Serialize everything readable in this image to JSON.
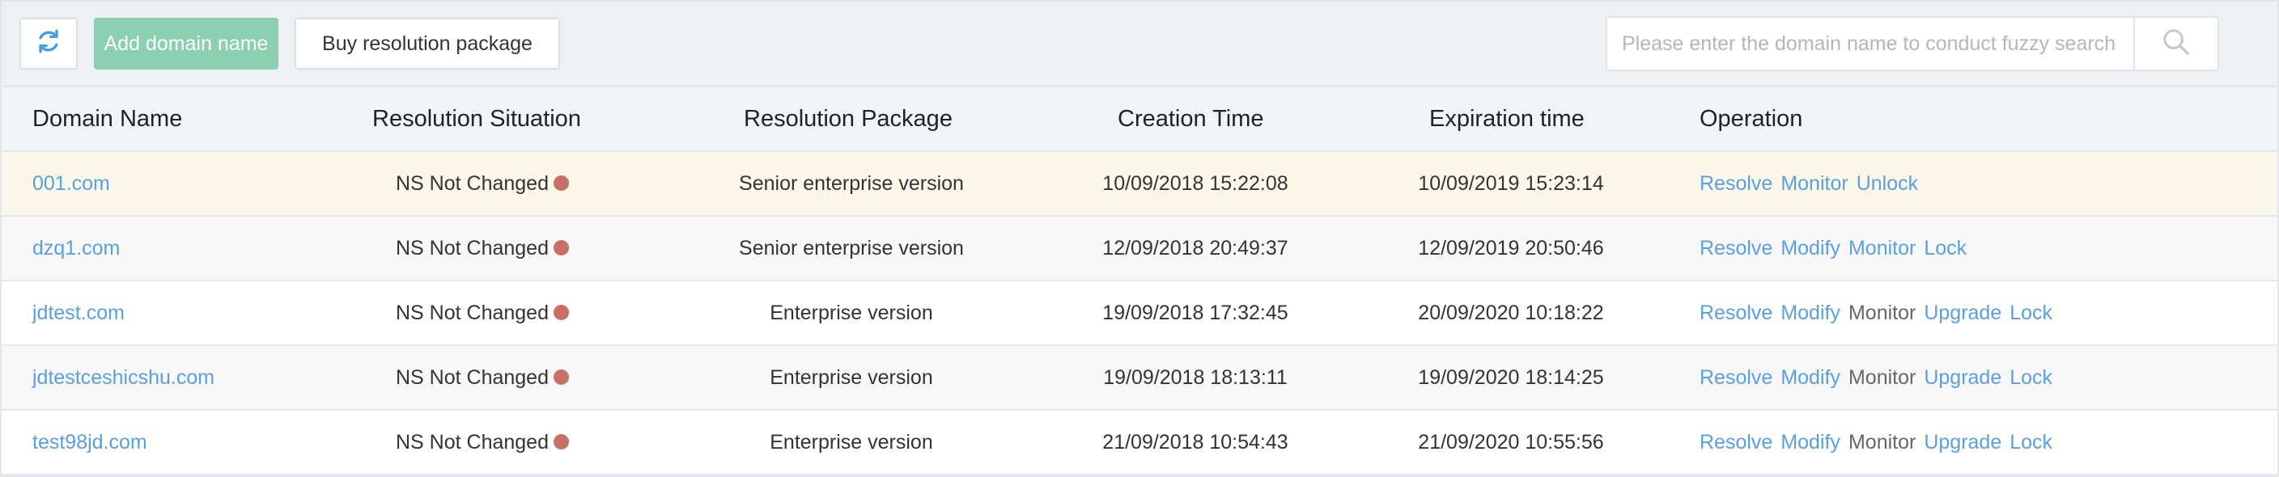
{
  "toolbar": {
    "refresh_icon": "refresh-icon",
    "add_domain_label": "Add domain name",
    "buy_package_label": "Buy resolution package",
    "search_placeholder": "Please enter the domain name to conduct fuzzy search",
    "search_icon": "search-icon"
  },
  "colors": {
    "accent_link": "#5a9fe0",
    "add_button_bg": "#8ccfb1",
    "status_dot": "#c87068",
    "highlight_row": "#fbf8ea"
  },
  "table": {
    "headers": [
      "Domain Name",
      "Resolution Situation",
      "Resolution Package",
      "Creation Time",
      "Expiration time",
      "Operation"
    ],
    "rows": [
      {
        "domain": "001.com",
        "status": "NS Not Changed",
        "package": "Senior enterprise version",
        "created": "10/09/2018 15:22:08",
        "expires": "10/09/2019 15:23:14",
        "ops": [
          {
            "label": "Resolve",
            "enabled": true
          },
          {
            "label": "Monitor",
            "enabled": true
          },
          {
            "label": "Unlock",
            "enabled": true
          }
        ]
      },
      {
        "domain": "dzq1.com",
        "status": "NS Not Changed",
        "package": "Senior enterprise version",
        "created": "12/09/2018 20:49:37",
        "expires": "12/09/2019 20:50:46",
        "ops": [
          {
            "label": "Resolve",
            "enabled": true
          },
          {
            "label": "Modify",
            "enabled": true
          },
          {
            "label": "Monitor",
            "enabled": true
          },
          {
            "label": "Lock",
            "enabled": true
          }
        ]
      },
      {
        "domain": "jdtest.com",
        "status": "NS Not Changed",
        "package": "Enterprise version",
        "created": "19/09/2018 17:32:45",
        "expires": "20/09/2020 10:18:22",
        "ops": [
          {
            "label": "Resolve",
            "enabled": true
          },
          {
            "label": "Modify",
            "enabled": true
          },
          {
            "label": "Monitor",
            "enabled": false
          },
          {
            "label": "Upgrade",
            "enabled": true
          },
          {
            "label": "Lock",
            "enabled": true
          }
        ]
      },
      {
        "domain": "jdtestceshicshu.com",
        "status": "NS Not Changed",
        "package": "Enterprise version",
        "created": "19/09/2018 18:13:11",
        "expires": "19/09/2020 18:14:25",
        "ops": [
          {
            "label": "Resolve",
            "enabled": true
          },
          {
            "label": "Modify",
            "enabled": true
          },
          {
            "label": "Monitor",
            "enabled": false
          },
          {
            "label": "Upgrade",
            "enabled": true
          },
          {
            "label": "Lock",
            "enabled": true
          }
        ]
      },
      {
        "domain": "test98jd.com",
        "status": "NS Not Changed",
        "package": "Enterprise version",
        "created": "21/09/2018 10:54:43",
        "expires": "21/09/2020 10:55:56",
        "ops": [
          {
            "label": "Resolve",
            "enabled": true
          },
          {
            "label": "Modify",
            "enabled": true
          },
          {
            "label": "Monitor",
            "enabled": false
          },
          {
            "label": "Upgrade",
            "enabled": true
          },
          {
            "label": "Lock",
            "enabled": true
          }
        ]
      }
    ]
  }
}
